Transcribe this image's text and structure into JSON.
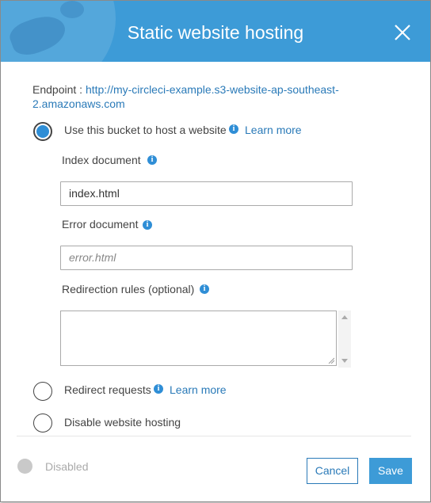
{
  "dialog": {
    "title": "Static website hosting"
  },
  "endpoint": {
    "label": "Endpoint :",
    "url": "http://my-circleci-example.s3-website-ap-southeast-2.amazonaws.com"
  },
  "options": {
    "host": {
      "label": "Use this bucket to host a website",
      "link": "Learn more",
      "selected": true
    },
    "redirect": {
      "label": "Redirect requests",
      "link": "Learn more",
      "selected": false
    },
    "disable": {
      "label": "Disable website hosting",
      "selected": false
    }
  },
  "fields": {
    "index": {
      "label": "Index document",
      "value": "index.html"
    },
    "error": {
      "label": "Error document",
      "placeholder": "error.html",
      "value": ""
    },
    "redirection": {
      "label": "Redirection rules (optional)",
      "value": ""
    }
  },
  "footer": {
    "status": "Disabled",
    "cancel": "Cancel",
    "save": "Save"
  },
  "colors": {
    "header": "#3d9bd7",
    "link": "#2a7ab8",
    "radio_selected": "#2f8ed6"
  },
  "icons": {
    "close": "close-icon",
    "info": "info-icon"
  }
}
